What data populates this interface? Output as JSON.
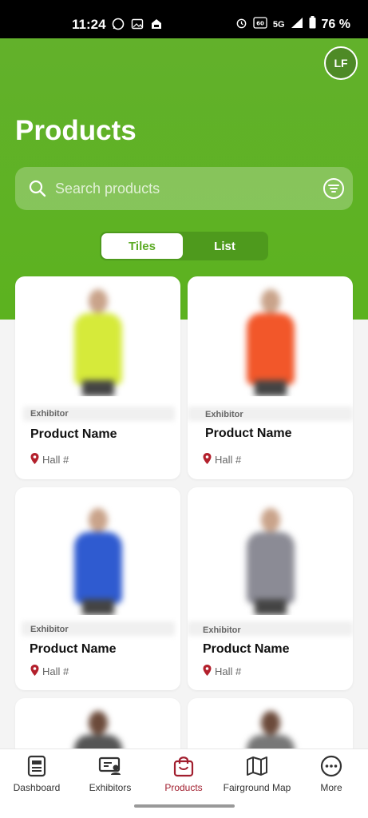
{
  "status_bar": {
    "time": "11:24",
    "network": "5G",
    "battery": "76 %"
  },
  "header": {
    "avatar_initials": "LF",
    "title": "Products"
  },
  "search": {
    "placeholder": "Search products"
  },
  "view_toggle": {
    "tiles_label": "Tiles",
    "list_label": "List",
    "selected": "Tiles"
  },
  "products": [
    {
      "exhibitor": "Exhibitor",
      "name": "Product Name",
      "hall": "Hall #",
      "vest_color": "#d6ea3a"
    },
    {
      "exhibitor": "Exhibitor",
      "name": "Product Name",
      "hall": "Hall #",
      "vest_color": "#f2572a"
    },
    {
      "exhibitor": "Exhibitor",
      "name": "Product Name",
      "hall": "Hall #",
      "vest_color": "#2f5bd0"
    },
    {
      "exhibitor": "Exhibitor",
      "name": "Product Name",
      "hall": "Hall #",
      "vest_color": "#8b8b95"
    }
  ],
  "bottom_nav": [
    {
      "label": "Dashboard",
      "icon": "dashboard-icon",
      "active": false
    },
    {
      "label": "Exhibitors",
      "icon": "exhibitors-icon",
      "active": false
    },
    {
      "label": "Products",
      "icon": "shopping-bag-icon",
      "active": true
    },
    {
      "label": "Fairground Map",
      "icon": "map-icon",
      "active": false
    },
    {
      "label": "More",
      "icon": "more-icon",
      "active": false
    }
  ],
  "colors": {
    "header_green": "#5cb21f",
    "active_nav": "#a11e2e",
    "pin_red": "#b3202c"
  }
}
